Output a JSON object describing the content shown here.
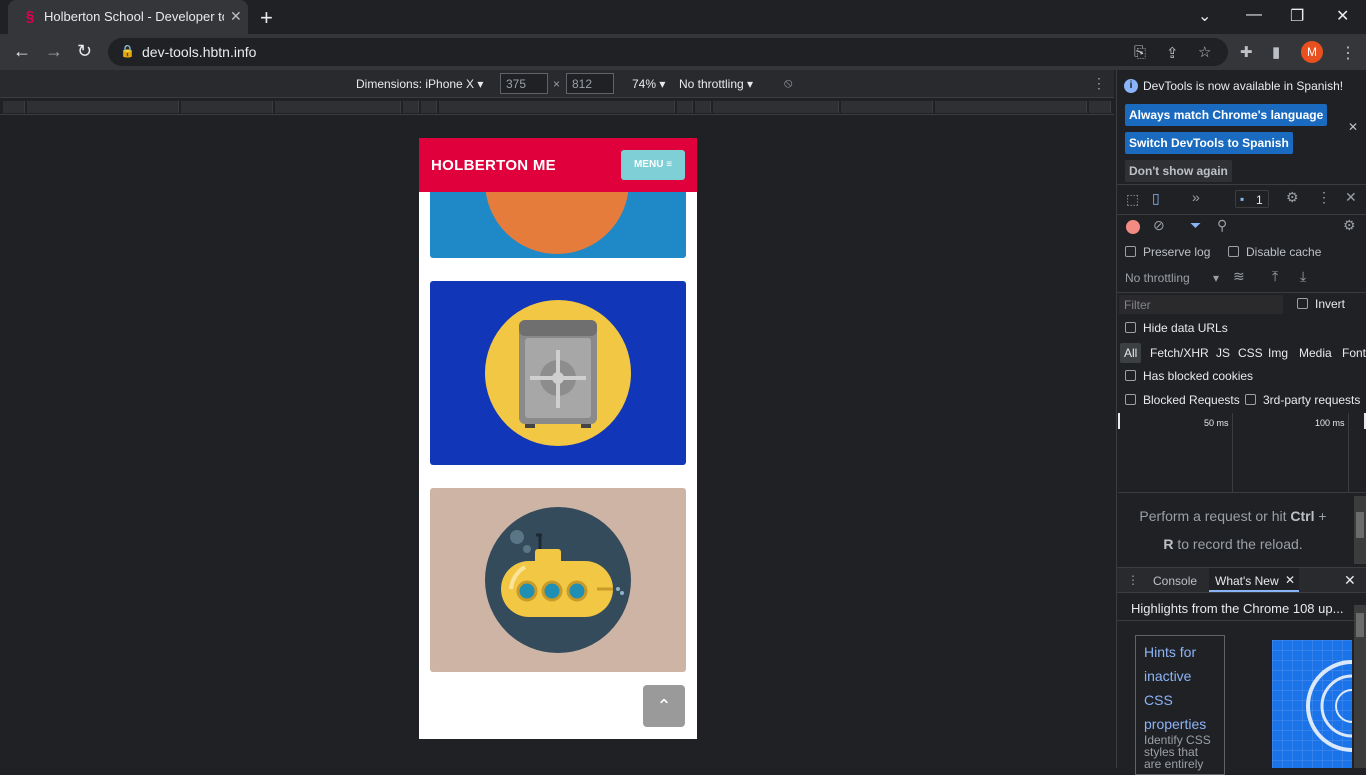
{
  "browser": {
    "tab_title": "Holberton School - Developer to",
    "url": "dev-tools.hbtn.info",
    "avatar_letter": "M",
    "brand_color": "#e0003c"
  },
  "device_toolbar": {
    "dimensions_label": "Dimensions: iPhone X",
    "width": "375",
    "height": "812",
    "zoom": "74%",
    "throttling": "No throttling"
  },
  "page": {
    "brand": "HOLBERTON ME",
    "menu_label": "MENU ≡",
    "cards": [
      {
        "name": "orange-circle-card",
        "bg": "#1f88c7",
        "circle": "#e57c3c"
      },
      {
        "name": "safe-card",
        "bg": "#1236b8",
        "circle": "#f2c744"
      },
      {
        "name": "submarine-card",
        "bg": "#cdb4a5",
        "circle": "#344b5c"
      }
    ],
    "back_to_top_icon": "chevron-up-icon"
  },
  "devtools": {
    "notice": "DevTools is now available in Spanish!",
    "always_match": "Always match Chrome's language",
    "switch_spanish": "Switch DevTools to Spanish",
    "dont_show": "Don't show again",
    "issues_count": "1",
    "preserve_log": "Preserve log",
    "disable_cache": "Disable cache",
    "no_throttling": "No throttling",
    "filter_placeholder": "Filter",
    "invert": "Invert",
    "hide_data_urls": "Hide data URLs",
    "type_filters": [
      "All",
      "Fetch/XHR",
      "JS",
      "CSS",
      "Img",
      "Media",
      "Font"
    ],
    "has_blocked_cookies": "Has blocked cookies",
    "blocked_requests": "Blocked Requests",
    "third_party": "3rd-party requests",
    "tick_50": "50 ms",
    "tick_100": "100 ms",
    "empty_msg_1": "Perform a request or hit",
    "empty_msg_ctrl": "Ctrl",
    "empty_msg_plus": "+",
    "empty_msg_r": "R",
    "empty_msg_2": "to record the reload.",
    "drawer_console": "Console",
    "drawer_whats_new": "What's New",
    "highlights": "Highlights from the Chrome 108 up...",
    "hint_title_1": "Hints for",
    "hint_title_2": "inactive",
    "hint_title_3": "CSS",
    "hint_title_4": "properties",
    "hint_desc_1": "Identify CSS",
    "hint_desc_2": "styles that",
    "hint_desc_3": "are entirely"
  }
}
